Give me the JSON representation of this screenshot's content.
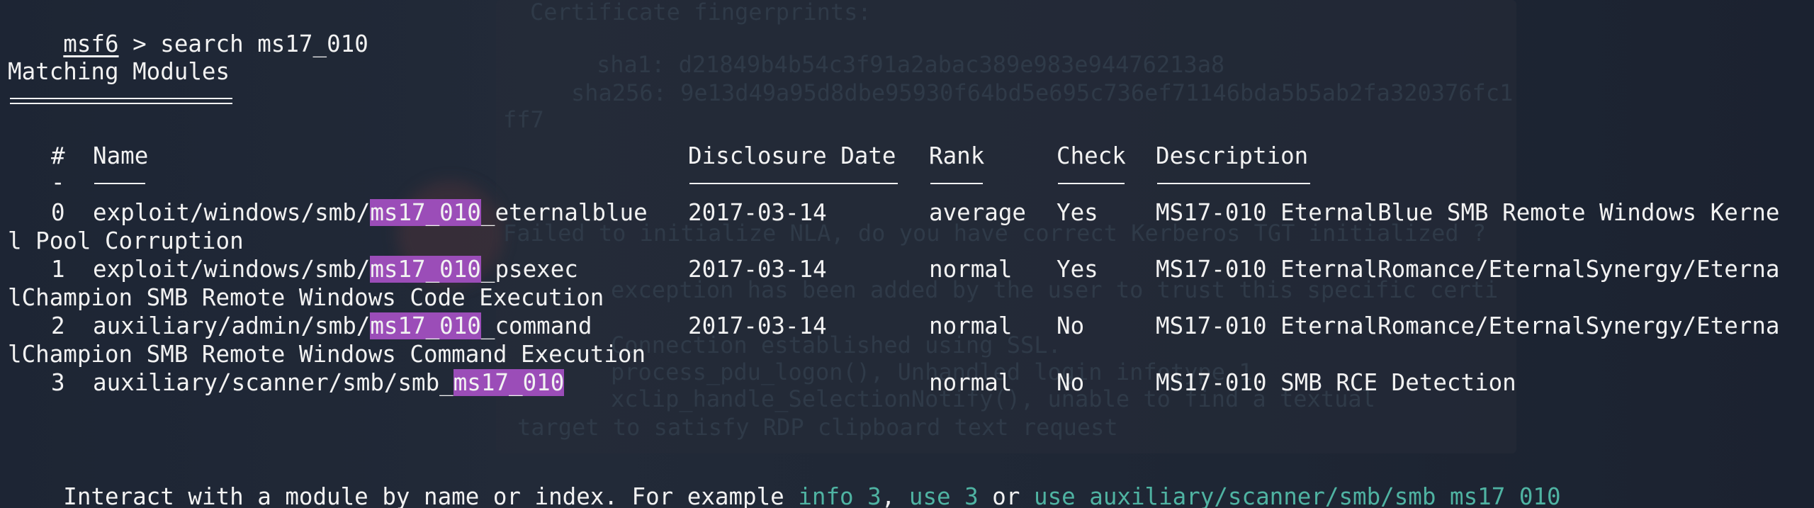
{
  "prompt": {
    "name": "msf6",
    "separator": " > ",
    "command": "search ms17_010"
  },
  "section_title": "Matching Modules",
  "columns": {
    "num": "#",
    "name": "Name",
    "date": "Disclosure Date",
    "rank": "Rank",
    "check": "Check",
    "description": "Description",
    "num_rule": "-"
  },
  "rows": [
    {
      "num": "0",
      "path_pre": "exploit/windows/smb/",
      "match": "ms17_010",
      "path_post": "_eternalblue",
      "date": "2017-03-14",
      "rank": "average",
      "check": "Yes",
      "desc_1": "MS17-010 EternalBlue SMB Remote Windows Kerne",
      "desc_2": "l Pool Corruption"
    },
    {
      "num": "1",
      "path_pre": "exploit/windows/smb/",
      "match": "ms17_010",
      "path_post": "_psexec",
      "date": "2017-03-14",
      "rank": "normal",
      "check": "Yes",
      "desc_1": "MS17-010 EternalRomance/EternalSynergy/Eterna",
      "desc_2": "lChampion SMB Remote Windows Code Execution"
    },
    {
      "num": "2",
      "path_pre": "auxiliary/admin/smb/",
      "match": "ms17_010",
      "path_post": "_command",
      "date": "2017-03-14",
      "rank": "normal",
      "check": "No",
      "desc_1": "MS17-010 EternalRomance/EternalSynergy/Eterna",
      "desc_2": "lChampion SMB Remote Windows Command Execution"
    },
    {
      "num": "3",
      "path_pre": "auxiliary/scanner/smb/smb_",
      "match": "ms17_010",
      "path_post": "",
      "date": "",
      "rank": "normal",
      "check": "No",
      "desc_1": "MS17-010 SMB RCE Detection",
      "desc_2": ""
    }
  ],
  "footer": {
    "text": "Interact with a module by name or index. For example ",
    "hint1": "info 3",
    "sep1": ", ",
    "hint2": "use 3",
    "sep2": " or ",
    "hint3": "use auxiliary/scanner/smb/smb_ms17_010"
  },
  "background_lines": [
    "Certificate fingerprints:",
    "sha1: d21849b4b54c3f91a2abac389e983e94476213a8",
    "sha256: 9e13d49a95d8dbe95930f64bd5e695c736ef71146bda5b5ab2fa320376fc1",
    "ff7",
    "Failed to initialize NLA, do you have correct Kerberos TGT initialized ?",
    "exception has been added by the user to trust this specific certi",
    "Connection established using SSL.",
    "process_pdu_logon(), Unhandled login infotype 1",
    "xclip_handle_SelectionNotify(), unable to find a textual",
    "target to satisfy RDP clipboard text request"
  ],
  "colors": {
    "highlight": "#9b4db8",
    "hint": "#4fb3a2",
    "text": "#f2f2f2",
    "background": "#1c2433"
  }
}
